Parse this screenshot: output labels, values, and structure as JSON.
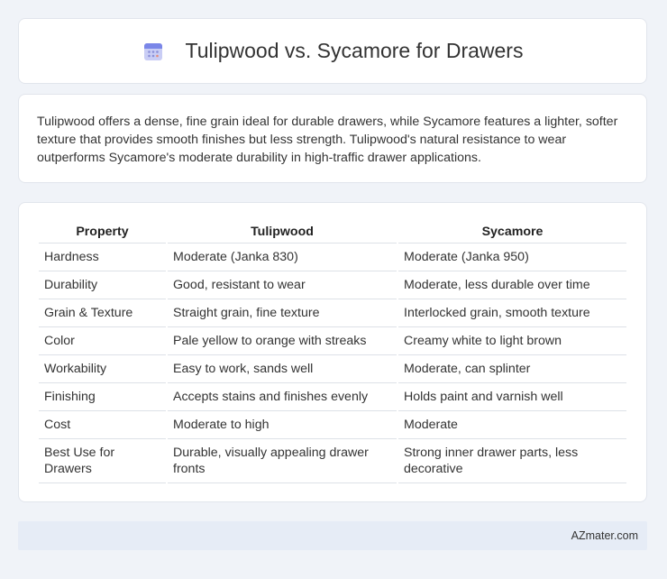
{
  "header": {
    "title": "Tulipwood vs. Sycamore for Drawers",
    "icon": "calendar-icon"
  },
  "summary": {
    "text": "Tulipwood offers a dense, fine grain ideal for durable drawers, while Sycamore features a lighter, softer texture that provides smooth finishes but less strength. Tulipwood's natural resistance to wear outperforms Sycamore's moderate durability in high-traffic drawer applications."
  },
  "table": {
    "headers": [
      "Property",
      "Tulipwood",
      "Sycamore"
    ],
    "rows": [
      [
        "Hardness",
        "Moderate (Janka 830)",
        "Moderate (Janka 950)"
      ],
      [
        "Durability",
        "Good, resistant to wear",
        "Moderate, less durable over time"
      ],
      [
        "Grain & Texture",
        "Straight grain, fine texture",
        "Interlocked grain, smooth texture"
      ],
      [
        "Color",
        "Pale yellow to orange with streaks",
        "Creamy white to light brown"
      ],
      [
        "Workability",
        "Easy to work, sands well",
        "Moderate, can splinter"
      ],
      [
        "Finishing",
        "Accepts stains and finishes evenly",
        "Holds paint and varnish well"
      ],
      [
        "Cost",
        "Moderate to high",
        "Moderate"
      ],
      [
        "Best Use for Drawers",
        "Durable, visually appealing drawer fronts",
        "Strong inner drawer parts, less decorative"
      ]
    ]
  },
  "footer": {
    "brand": "AZmater.com"
  }
}
